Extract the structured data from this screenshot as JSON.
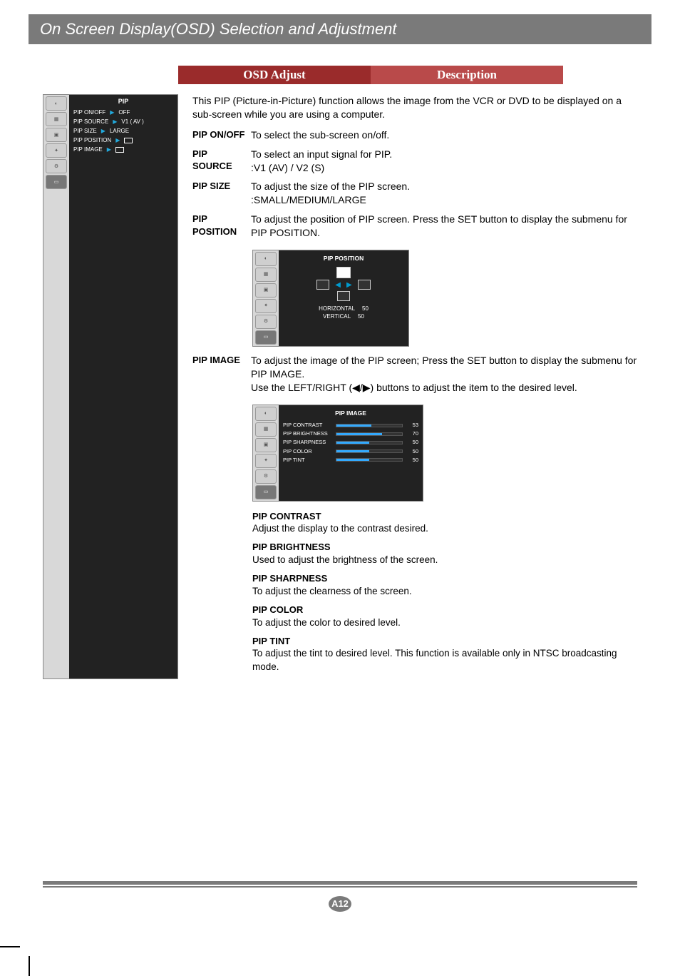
{
  "title": "On Screen Display(OSD) Selection and Adjustment",
  "bar": {
    "left": "OSD Adjust",
    "right": "Description"
  },
  "osd_panel": {
    "title": "PIP",
    "side_labels": [
      "",
      "",
      "",
      "",
      "",
      ""
    ],
    "items": [
      {
        "label": "PIP ON/OFF",
        "value": "OFF"
      },
      {
        "label": "PIP SOURCE",
        "value": "V1 ( AV )"
      },
      {
        "label": "PIP SIZE",
        "value": "LARGE"
      },
      {
        "label": "PIP POSITION",
        "value": ""
      },
      {
        "label": "PIP IMAGE",
        "value": ""
      }
    ]
  },
  "intro": "This PIP (Picture-in-Picture) function allows the image from the VCR or DVD to be displayed on a sub-screen while you are using a computer.",
  "defs": [
    {
      "term": "PIP ON/OFF",
      "def": "To select the sub-screen on/off."
    },
    {
      "term": "PIP SOURCE",
      "def": "To select an input signal for PIP.\n:V1 (AV) / V2 (S)"
    },
    {
      "term": "PIP SIZE",
      "def": "To adjust the size of the PIP screen.\n:SMALL/MEDIUM/LARGE"
    },
    {
      "term": "PIP POSITION",
      "def": "To adjust the position of PIP screen. Press the SET button to display the submenu for PIP POSITION."
    }
  ],
  "pip_position_panel": {
    "title": "PIP POSITION",
    "horizontal_label": "HORIZONTAL",
    "horizontal_value": "50",
    "vertical_label": "VERTICAL",
    "vertical_value": "50"
  },
  "pip_image_def": {
    "term": "PIP IMAGE",
    "def": "To adjust the image of the PIP screen; Press the SET button to display the submenu for PIP IMAGE.\nUse the LEFT/RIGHT (◀/▶) buttons to adjust the item to the desired level."
  },
  "pip_image_panel": {
    "title": "PIP IMAGE",
    "rows": [
      {
        "label": "PIP CONTRAST",
        "value": 53
      },
      {
        "label": "PIP BRIGHTNESS",
        "value": 70
      },
      {
        "label": "PIP SHARPNESS",
        "value": 50
      },
      {
        "label": "PIP COLOR",
        "value": 50
      },
      {
        "label": "PIP TINT",
        "value": 50
      }
    ]
  },
  "subs": [
    {
      "title": "PIP CONTRAST",
      "desc": "Adjust the display to the contrast desired."
    },
    {
      "title": "PIP BRIGHTNESS",
      "desc": "Used to adjust the brightness of the screen."
    },
    {
      "title": "PIP SHARPNESS",
      "desc": "To adjust the clearness of the screen."
    },
    {
      "title": "PIP COLOR",
      "desc": "To adjust the color to desired level."
    },
    {
      "title": "PIP TINT",
      "desc": "To adjust the tint to desired level. This function is available only in NTSC broadcasting mode."
    }
  ],
  "page_number": "A12"
}
